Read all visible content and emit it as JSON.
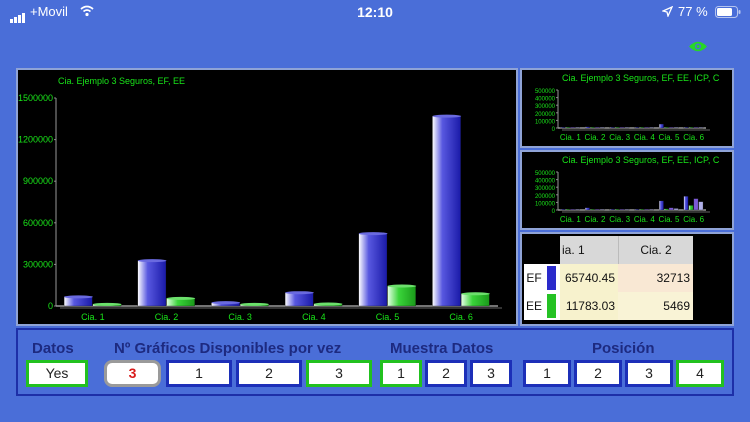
{
  "status_bar": {
    "carrier": "+Movil",
    "time": "12:10",
    "battery": "77 %"
  },
  "colors": {
    "background": "#4a6ed8",
    "series_ef": "#2a2acb",
    "series_ee": "#25c225",
    "chart_text": "#19e519",
    "active_border": "#22c11f",
    "inactive_border": "#1c2fb8"
  },
  "charts": {
    "main_title": "Cia. Ejemplo 3 Seguros, EF, EE",
    "small1_title": "Cia. Ejemplo 3 Seguros, EF, EE, ICP, C",
    "small2_title": "Cia. Ejemplo 3 Seguros, EF, EE, ICP, C"
  },
  "chart_data": [
    {
      "type": "bar",
      "title": "Cia. Ejemplo 3 Seguros, EF, EE",
      "categories": [
        "Cia. 1",
        "Cia. 2",
        "Cia. 3",
        "Cia. 4",
        "Cia. 5",
        "Cia. 6"
      ],
      "series": [
        {
          "values": [
            65740,
            327130,
            24000,
            96000,
            522000,
            1369000
          ]
        },
        {
          "values": [
            11783,
            54690,
            12000,
            14000,
            144000,
            88000
          ]
        }
      ],
      "ytick_labels": [
        "0",
        "300000",
        "600000",
        "900000",
        "1200000",
        "1500000"
      ],
      "ylim": [
        0,
        1500000
      ]
    },
    {
      "type": "bar",
      "title": "Cia. Ejemplo 3 Seguros, EF, EE, ICP, C",
      "categories": [
        "Cia. 1",
        "Cia. 2",
        "Cia. 3",
        "Cia. 4",
        "Cia. 5",
        "Cia. 6"
      ],
      "series": [
        {
          "values": [
            4000,
            15000,
            3000,
            5000,
            52000,
            6000
          ]
        },
        {
          "values": [
            1000,
            2000,
            1000,
            1000,
            3000,
            4000
          ]
        },
        {
          "values": [
            500,
            1500,
            500,
            800,
            2000,
            8000
          ]
        },
        {
          "values": [
            300,
            800,
            300,
            500,
            1500,
            9000
          ]
        }
      ],
      "ytick_labels": [
        "0",
        "100000",
        "200000",
        "300000",
        "400000",
        "500000"
      ],
      "ylim": [
        0,
        500000
      ]
    },
    {
      "type": "bar",
      "title": "Cia. Ejemplo 3 Seguros, EF, EE, ICP, C",
      "categories": [
        "Cia. 1",
        "Cia. 2",
        "Cia. 3",
        "Cia. 4",
        "Cia. 5",
        "Cia. 6"
      ],
      "series": [
        {
          "values": [
            8000,
            30000,
            5000,
            10000,
            120000,
            180000
          ]
        },
        {
          "values": [
            2000,
            5000,
            2000,
            3000,
            15000,
            60000
          ]
        },
        {
          "values": [
            1000,
            8000,
            1000,
            2000,
            30000,
            150000
          ]
        },
        {
          "values": [
            800,
            6000,
            800,
            1500,
            20000,
            110000
          ]
        }
      ],
      "ytick_labels": [
        "0",
        "100000",
        "200000",
        "300000",
        "400000",
        "500000"
      ],
      "ylim": [
        0,
        500000
      ]
    }
  ],
  "table": {
    "columns": [
      "ia. 1",
      "Cia. 2"
    ],
    "rows": [
      {
        "label": "EF",
        "values": [
          "65740.45",
          "32713"
        ]
      },
      {
        "label": "EE",
        "values": [
          "11783.03",
          "5469"
        ]
      }
    ]
  },
  "controls": {
    "datos_label": "Datos",
    "datos_value": "Yes",
    "graficos_label": "Nº Gráficos Disponibles por vez",
    "graficos_current": "3",
    "graficos_options": [
      "1",
      "2",
      "3"
    ],
    "muestra_label": "Muestra Datos",
    "muestra_options": [
      "1",
      "2",
      "3"
    ],
    "posicion_label": "Posición",
    "posicion_options": [
      "1",
      "2",
      "3",
      "4"
    ]
  }
}
